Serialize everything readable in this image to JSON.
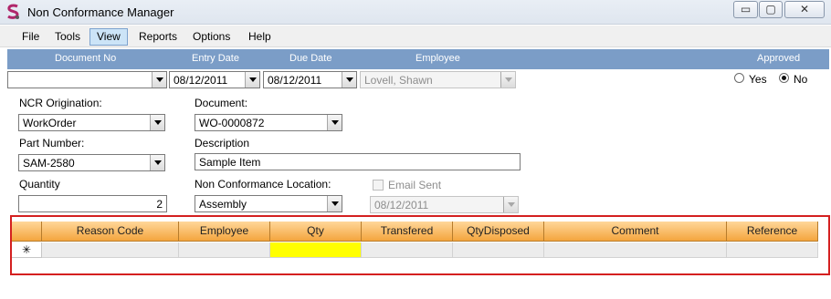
{
  "window": {
    "title": "Non Conformance Manager",
    "minimize_glyph": "▭",
    "maximize_glyph": "▢",
    "close_glyph": "✕"
  },
  "menu": [
    "File",
    "Tools",
    "View",
    "Reports",
    "Options",
    "Help"
  ],
  "menu_active": "View",
  "header": {
    "document_no": "Document No",
    "entry_date": "Entry Date",
    "due_date": "Due Date",
    "employee": "Employee",
    "approved": "Approved"
  },
  "top_row": {
    "document_no_value": "",
    "entry_date_value": "08/12/2011",
    "due_date_value": "08/12/2011",
    "employee_value": "Lovell, Shawn",
    "approved_yes": "Yes",
    "approved_no": "No",
    "approved_selected": "No"
  },
  "form": {
    "ncr_origination_label": "NCR Origination:",
    "ncr_origination_value": "WorkOrder",
    "document_label": "Document:",
    "document_value": "WO-0000872",
    "part_number_label": "Part Number:",
    "part_number_value": "SAM-2580",
    "description_label": "Description",
    "description_value": "Sample Item",
    "quantity_label": "Quantity",
    "quantity_value": "2",
    "location_label": "Non Conformance Location:",
    "location_value": "Assembly",
    "email_sent_label": "Email Sent",
    "email_date_value": "08/12/2011"
  },
  "grid": {
    "columns": [
      "Reason Code",
      "Employee",
      "Qty",
      "Transfered",
      "QtyDisposed",
      "Comment",
      "Reference"
    ],
    "new_row_marker": "✳"
  },
  "colors": {
    "header_band": "#7b9dc7",
    "grid_header": "#f4a53e",
    "highlight_border": "#d42020",
    "qty_cell": "#ffff00"
  }
}
